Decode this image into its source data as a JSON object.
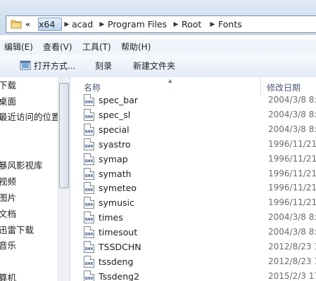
{
  "address": {
    "overflow": "«",
    "crumbs": [
      "x64",
      "acad",
      "Program Files",
      "Root",
      "Fonts"
    ]
  },
  "menu": {
    "items": [
      "编辑(E)",
      "查看(V)",
      "工具(T)",
      "帮助(H)"
    ]
  },
  "toolbar": {
    "open_with": "打开方式...",
    "burn": "刻录",
    "new_folder": "新建文件夹"
  },
  "nav": {
    "items": [
      "下载",
      "桌面",
      "最近访问的位置",
      "暴风影视库",
      "视频",
      "图片",
      "文档",
      "迅雷下载",
      "音乐",
      "算机"
    ]
  },
  "columns": {
    "name": "名称",
    "modified": "修改日期"
  },
  "files": [
    {
      "name": "spec_bar",
      "date": "2004/3/8 8:2",
      "icon": "SHX"
    },
    {
      "name": "spec_sl",
      "date": "2004/3/8 8:2",
      "icon": "SHX"
    },
    {
      "name": "special",
      "date": "2004/3/8 8:2",
      "icon": "SHX"
    },
    {
      "name": "syastro",
      "date": "1996/11/21",
      "icon": "SHX"
    },
    {
      "name": "symap",
      "date": "1996/11/21",
      "icon": "SHX"
    },
    {
      "name": "symath",
      "date": "1996/11/21",
      "icon": "SHX"
    },
    {
      "name": "symeteo",
      "date": "1996/11/21",
      "icon": "SHX"
    },
    {
      "name": "symusic",
      "date": "1996/11/21",
      "icon": "SHX"
    },
    {
      "name": "times",
      "date": "2004/3/8 8:2",
      "icon": "SHX"
    },
    {
      "name": "timesout",
      "date": "2004/3/8 8:2",
      "icon": "SHX"
    },
    {
      "name": "TSSDCHN",
      "date": "2012/8/23 1",
      "icon": "SHX"
    },
    {
      "name": "tssdeng",
      "date": "2012/8/23 1",
      "icon": "SHX"
    },
    {
      "name": "Tssdeng2",
      "date": "2015/2/3 17",
      "icon": "SHX"
    }
  ]
}
